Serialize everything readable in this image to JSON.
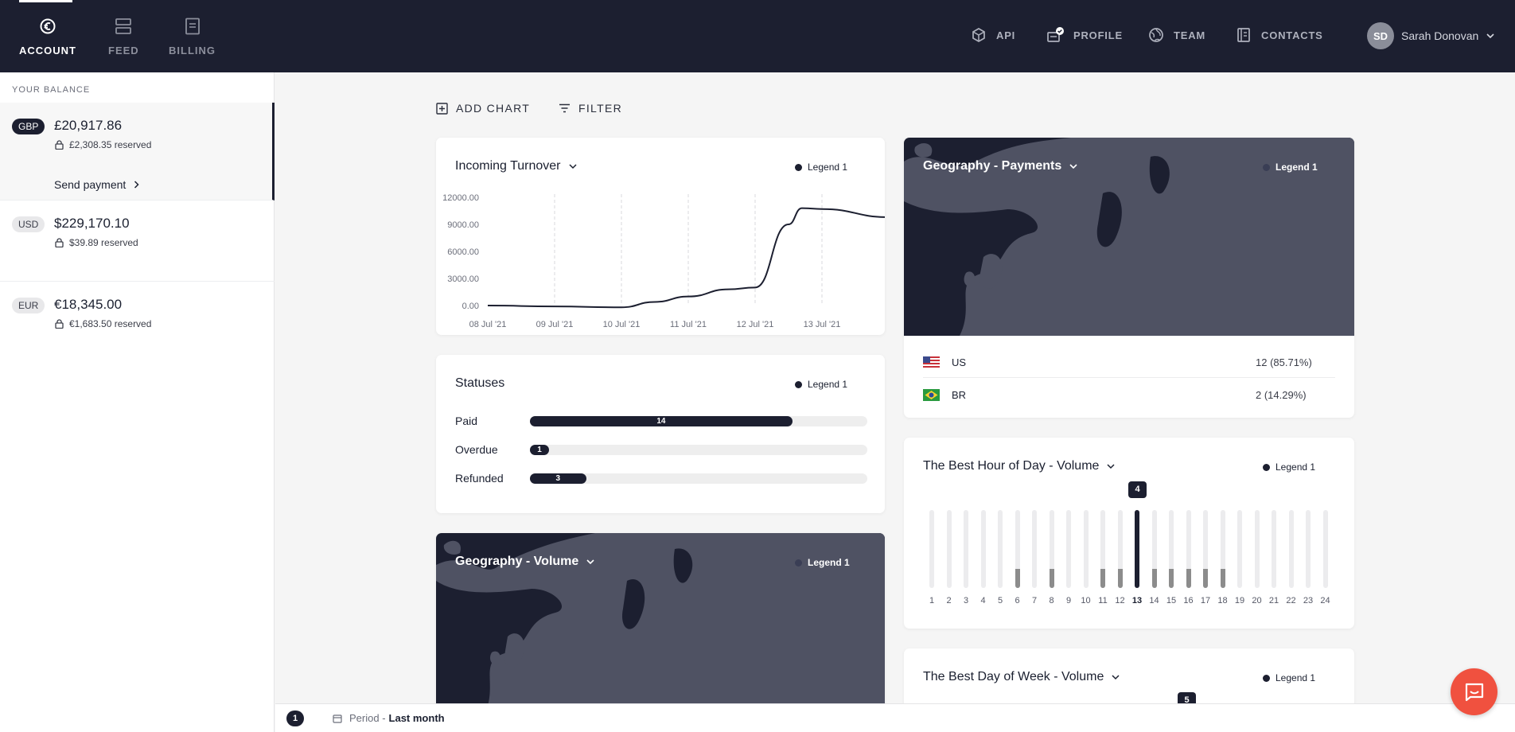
{
  "nav": {
    "tabs": [
      {
        "label": "ACCOUNT",
        "icon": "euro-coin-icon",
        "active": true
      },
      {
        "label": "FEED",
        "icon": "feed-icon",
        "active": false
      },
      {
        "label": "BILLING",
        "icon": "billing-icon",
        "active": false
      }
    ],
    "right_items": [
      {
        "label": "API",
        "icon": "cube-icon"
      },
      {
        "label": "PROFILE",
        "icon": "profile-icon"
      },
      {
        "label": "TEAM",
        "icon": "globe-icon"
      },
      {
        "label": "CONTACTS",
        "icon": "contacts-icon"
      }
    ],
    "user": {
      "initials": "SD",
      "name": "Sarah Donovan"
    }
  },
  "sidebar": {
    "title": "YOUR BALANCE",
    "accounts": [
      {
        "currency": "GBP",
        "amount": "£20,917.86",
        "reserved": "£2,308.35 reserved",
        "action": "Send payment",
        "selected": true
      },
      {
        "currency": "USD",
        "amount": "$229,170.10",
        "reserved": "$39.89 reserved",
        "selected": false
      },
      {
        "currency": "EUR",
        "amount": "€18,345.00",
        "reserved": "€1,683.50 reserved",
        "selected": false
      }
    ]
  },
  "toolbar": {
    "add_chart": "ADD CHART",
    "filter": "FILTER"
  },
  "cards": {
    "turnover": {
      "title": "Incoming Turnover",
      "legend": "Legend 1"
    },
    "statuses": {
      "title": "Statuses",
      "legend": "Legend 1"
    },
    "geo_volume": {
      "title": "Geography - Volume",
      "legend": "Legend 1"
    },
    "geo_payments": {
      "title": "Geography - Payments",
      "legend": "Legend 1",
      "rows": [
        {
          "country": "US",
          "value": "12 (85.71%)",
          "flag": "us-flag-icon"
        },
        {
          "country": "BR",
          "value": "2 (14.29%)",
          "flag": "br-flag-icon"
        }
      ]
    },
    "best_hour": {
      "title": "The Best Hour of Day - Volume",
      "legend": "Legend 1",
      "tooltip": "4"
    },
    "best_day": {
      "title": "The Best Day of Week - Volume",
      "legend": "Legend 1",
      "tooltip": "5"
    }
  },
  "chart_data": [
    {
      "type": "line",
      "title": "Incoming Turnover",
      "x": [
        "08 Jul '21",
        "09 Jul '21",
        "10 Jul '21",
        "11 Jul '21",
        "12 Jul '21",
        "13 Jul '21"
      ],
      "y_ticks": [
        "12000.00",
        "9000.00",
        "6000.00",
        "3000.00",
        "0.00"
      ],
      "ylim": [
        0,
        12000
      ],
      "series": [
        {
          "name": "Legend 1",
          "points": [
            [
              0,
              0
            ],
            [
              1,
              -100
            ],
            [
              2,
              -200
            ],
            [
              2.5,
              400
            ],
            [
              3,
              1000
            ],
            [
              3.6,
              1800
            ],
            [
              4,
              2000
            ],
            [
              4.5,
              9000
            ],
            [
              4.7,
              10800
            ],
            [
              5,
              10700
            ],
            [
              6,
              9800
            ]
          ]
        }
      ],
      "grid": "vertical dashed",
      "legend": "top-right"
    },
    {
      "type": "bar",
      "orientation": "horizontal",
      "title": "Statuses",
      "categories": [
        "Paid",
        "Overdue",
        "Refunded"
      ],
      "values": [
        14,
        1,
        3
      ],
      "max": 18
    },
    {
      "type": "bar",
      "title": "The Best Hour of Day - Volume",
      "categories": [
        "1",
        "2",
        "3",
        "4",
        "5",
        "6",
        "7",
        "8",
        "9",
        "10",
        "11",
        "12",
        "13",
        "14",
        "15",
        "16",
        "17",
        "18",
        "19",
        "20",
        "21",
        "22",
        "23",
        "24"
      ],
      "values": [
        0,
        0,
        0,
        0,
        0,
        1,
        0,
        1,
        0,
        0,
        1,
        1,
        4,
        1,
        1,
        1,
        1,
        1,
        0,
        0,
        0,
        0,
        0,
        0
      ],
      "max": 4,
      "highlight": "13"
    }
  ],
  "bottom": {
    "page": "1",
    "period_label": "Period - ",
    "period_value": "Last month"
  },
  "colors": {
    "nav_bg": "#1c1f30",
    "accent": "#1c1f30",
    "chat": "#f0513f",
    "map_land": "#4f5263"
  }
}
